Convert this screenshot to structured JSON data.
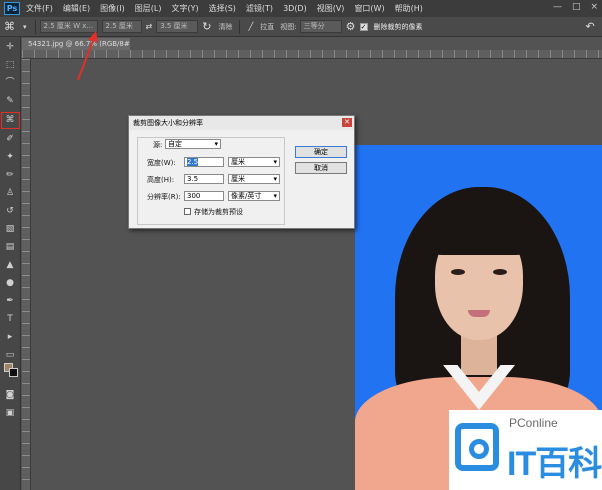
{
  "app": {
    "logo": "Ps"
  },
  "menubar": {
    "items": [
      "文件(F)",
      "编辑(E)",
      "图像(I)",
      "图层(L)",
      "文字(Y)",
      "选择(S)",
      "滤镜(T)",
      "3D(D)",
      "视图(V)",
      "窗口(W)",
      "帮助(H)"
    ],
    "window_controls": [
      "—",
      "□",
      "×"
    ]
  },
  "options_bar": {
    "ratio_value": "2.5 厘米 W x...",
    "width_value": "2.5 厘米",
    "height_value": "3.5 厘米",
    "clear_label": "清除",
    "straighten_label": "拉直",
    "view_label": "视图:",
    "view_value": "三等分",
    "delete_cropped_label": "删除裁剪的像素",
    "delete_cropped_checked": true
  },
  "document": {
    "tab_title": "54321.jpg @ 66.7% (RGB/8#)"
  },
  "dialog": {
    "title": "裁剪图像大小和分辨率",
    "preset_label": "源:",
    "preset_value": "自定",
    "width_label": "宽度(W):",
    "width_value": "2.5",
    "width_unit": "厘米",
    "height_label": "高度(H):",
    "height_value": "3.5",
    "height_unit": "厘米",
    "resolution_label": "分辨率(R):",
    "resolution_value": "300",
    "resolution_unit": "像素/英寸",
    "save_preset_label": "存储为裁剪预设",
    "ok_label": "确定",
    "cancel_label": "取消"
  },
  "watermark": {
    "top_text": "PConline",
    "brand_text": "IT百科"
  }
}
